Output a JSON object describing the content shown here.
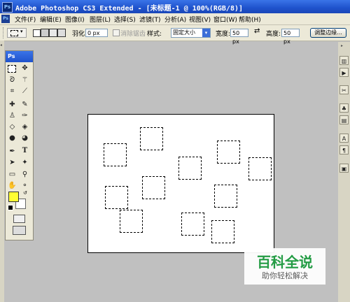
{
  "window": {
    "app_icon": "Ps",
    "title": "Adobe Photoshop CS3 Extended - [未标题-1 @ 100%(RGB/8)]"
  },
  "menu": [
    "文件(F)",
    "编辑(E)",
    "图像(I)",
    "图层(L)",
    "选择(S)",
    "滤镜(T)",
    "分析(A)",
    "视图(V)",
    "窗口(W)",
    "帮助(H)"
  ],
  "options_bar": {
    "feather_label": "羽化:",
    "feather_value": "0 px",
    "antialias_label": "消除锯齿",
    "style_label": "样式:",
    "style_value": "固定大小",
    "width_label": "宽度:",
    "width_value": "50 px",
    "height_label": "高度:",
    "height_value": "50 px",
    "refine_edge_button": "调整边缘..."
  },
  "toolbox": {
    "header": "Ps",
    "foreground_color": "#ffff33",
    "background_color": "#ffffff"
  },
  "document": {
    "selection_count": 12
  },
  "watermark": {
    "line1": "百科全说",
    "line2": "助你轻松解决"
  }
}
